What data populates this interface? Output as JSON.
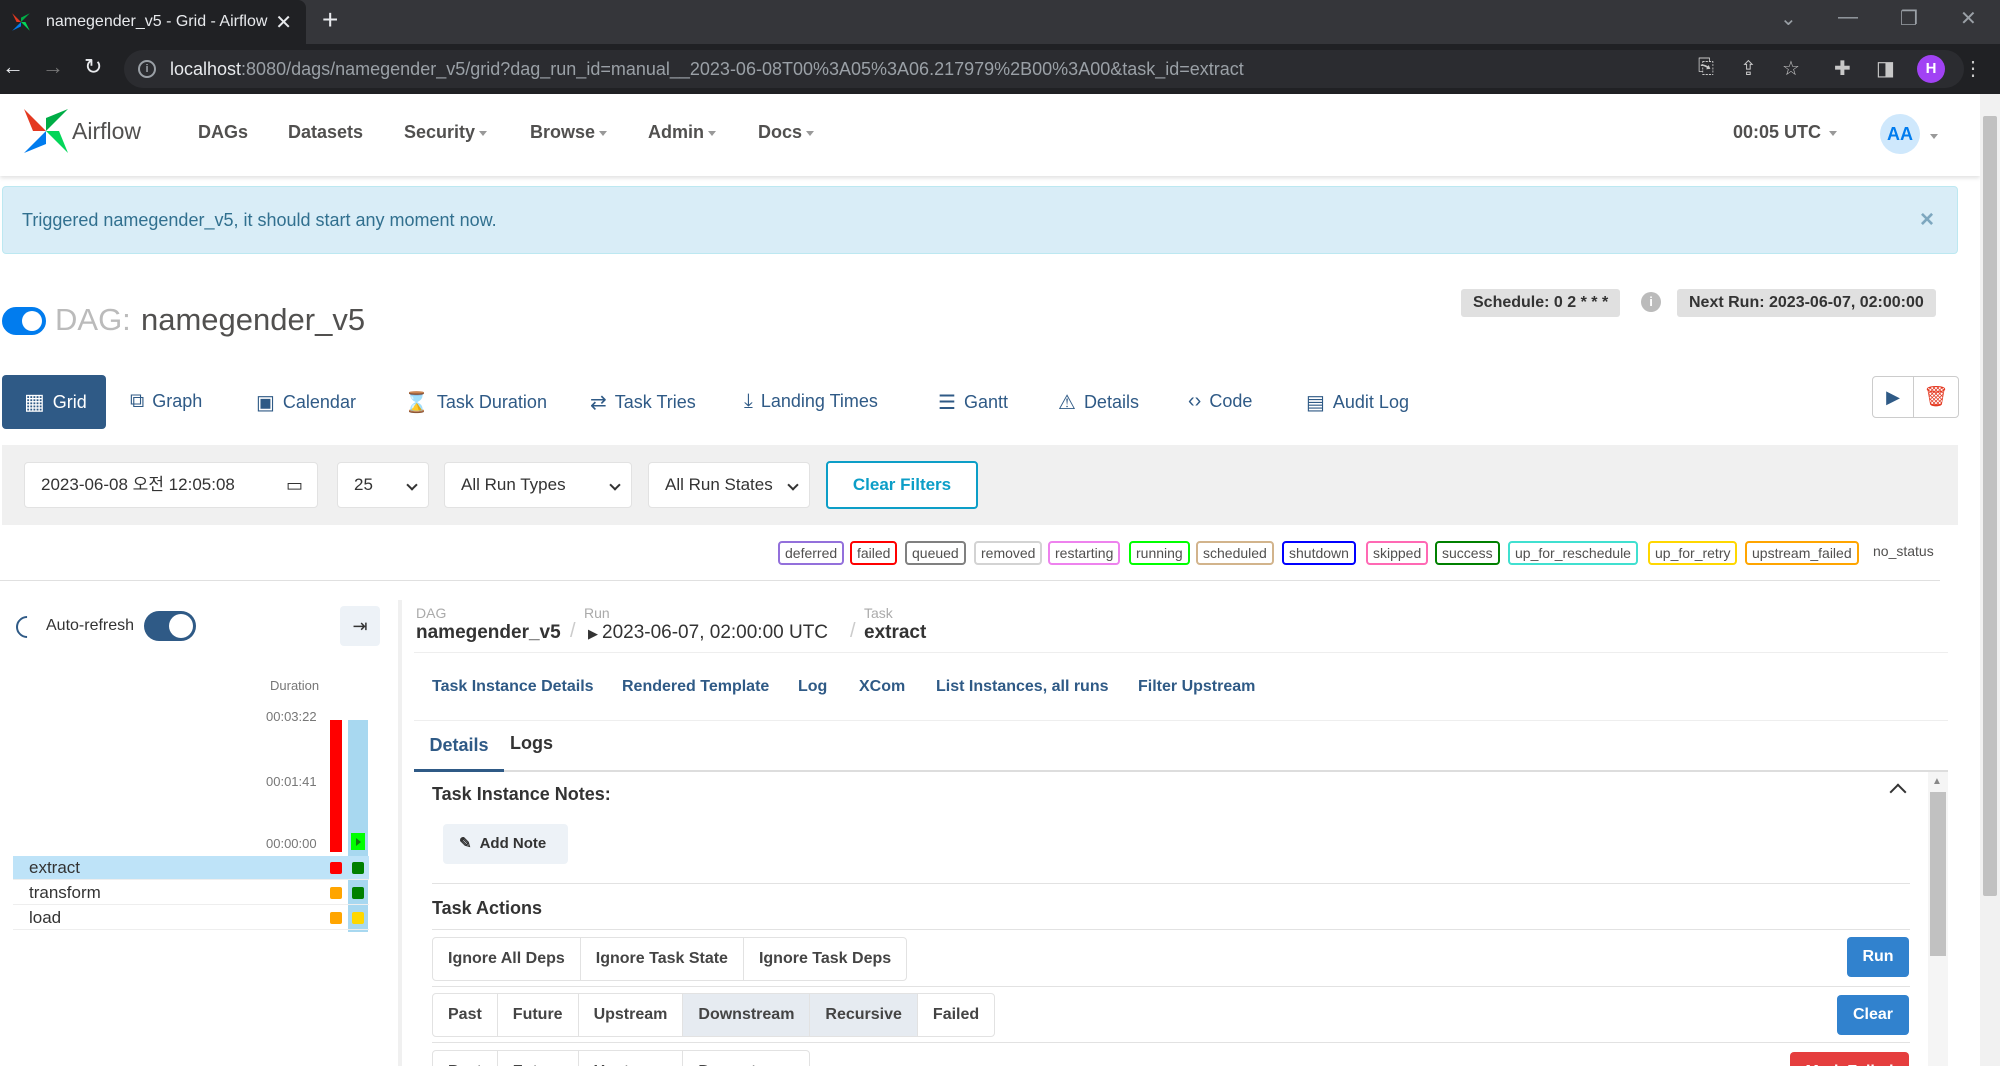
{
  "browser": {
    "tab_title": "namegender_v5 - Grid - Airflow",
    "url_host": "localhost",
    "url_path": ":8080/dags/namegender_v5/grid?dag_run_id=manual__2023-06-08T00%3A05%3A06.217979%2B00%3A00&task_id=extract",
    "profile_initial": "H"
  },
  "navbar": {
    "brand": "Airflow",
    "items": [
      "DAGs",
      "Datasets",
      "Security",
      "Browse",
      "Admin",
      "Docs"
    ],
    "time": "00:05 UTC",
    "user_initials": "AA"
  },
  "alert": {
    "message": "Triggered namegender_v5, it should start any moment now.",
    "close": "×"
  },
  "dag": {
    "prefix": "DAG:",
    "name": "namegender_v5",
    "schedule": "Schedule: 0 2 * * *",
    "next_run": "Next Run: 2023-06-07, 02:00:00",
    "is_active": true
  },
  "views": {
    "grid": "Grid",
    "graph": "Graph",
    "calendar": "Calendar",
    "task_duration": "Task Duration",
    "task_tries": "Task Tries",
    "landing_times": "Landing Times",
    "gantt": "Gantt",
    "details": "Details",
    "code": "Code",
    "audit_log": "Audit Log"
  },
  "filters": {
    "base_date": "2023-06-08 오전 12:05:08",
    "num_runs": "25",
    "run_type": "All Run Types",
    "run_state": "All Run States",
    "clear": "Clear Filters"
  },
  "legend": [
    {
      "label": "deferred",
      "color": "#9370db"
    },
    {
      "label": "failed",
      "color": "#ff0000"
    },
    {
      "label": "queued",
      "color": "#808080"
    },
    {
      "label": "removed",
      "color": "#d3d3d3"
    },
    {
      "label": "restarting",
      "color": "#ee82ee"
    },
    {
      "label": "running",
      "color": "#00ff00"
    },
    {
      "label": "scheduled",
      "color": "#d2b48c"
    },
    {
      "label": "shutdown",
      "color": "#0000ff"
    },
    {
      "label": "skipped",
      "color": "#ff69b4"
    },
    {
      "label": "success",
      "color": "#008000"
    },
    {
      "label": "up_for_reschedule",
      "color": "#40e0d0"
    },
    {
      "label": "up_for_retry",
      "color": "#ffd700"
    },
    {
      "label": "upstream_failed",
      "color": "#ffa500"
    }
  ],
  "legend_no_status": "no_status",
  "grid": {
    "auto_refresh_label": "Auto-refresh",
    "auto_refresh_on": true,
    "duration_label": "Duration",
    "duration_ticks": [
      "00:03:22",
      "00:01:41",
      "00:00:00"
    ],
    "tasks": [
      {
        "name": "extract",
        "states": [
          "#ff0000",
          "#008000"
        ]
      },
      {
        "name": "transform",
        "states": [
          "#ffa500",
          "#008000"
        ]
      },
      {
        "name": "load",
        "states": [
          "#ffa500",
          "#ffd700"
        ]
      }
    ]
  },
  "details": {
    "breadcrumb": {
      "dag_label": "DAG",
      "dag_value": "namegender_v5",
      "run_label": "Run",
      "run_value": "2023-06-07, 02:00:00 UTC",
      "task_label": "Task",
      "task_value": "extract",
      "sep": "/"
    },
    "links": [
      "Task Instance Details",
      "Rendered Template",
      "Log",
      "XCom",
      "List Instances, all runs",
      "Filter Upstream"
    ],
    "tabs": {
      "details": "Details",
      "logs": "Logs"
    },
    "notes_title": "Task Instance Notes:",
    "add_note": "Add Note",
    "actions_title": "Task Actions",
    "group1": [
      "Ignore All Deps",
      "Ignore Task State",
      "Ignore Task Deps"
    ],
    "run_label": "Run",
    "group2": [
      "Past",
      "Future",
      "Upstream",
      "Downstream",
      "Recursive",
      "Failed"
    ],
    "clear_label": "Clear",
    "group3": [
      "Past",
      "Future",
      "Upstream",
      "Downstream"
    ],
    "mark_failed_label": "Mark Failed"
  }
}
